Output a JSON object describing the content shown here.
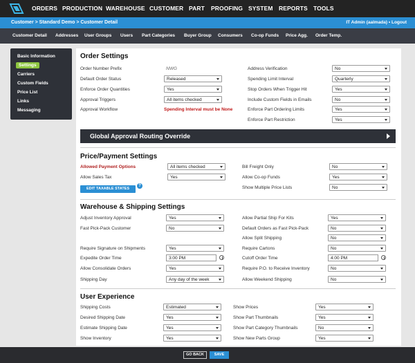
{
  "topnav": {
    "items": [
      "ORDERS",
      "PRODUCTION",
      "WAREHOUSE",
      "CUSTOMER",
      "PART",
      "PROOFING",
      "SYSTEM",
      "REPORTS",
      "TOOLS"
    ]
  },
  "breadcrumb": {
    "text": "Customer >  Standard Demo > Customer Detail",
    "user": "IT Admin (aalmada)",
    "separator": "•",
    "logout": "Logout"
  },
  "subnav": {
    "items": [
      "Customer Detail",
      "Addresses",
      "User Groups",
      "Users",
      "Part Categories",
      "Buyer Group",
      "Consumers",
      "Co-op Funds",
      "Price Agg.",
      "Order Temp."
    ]
  },
  "sidebar": {
    "items": [
      "Basic Information",
      "Settings",
      "Carriers",
      "Custom Fields",
      "Price List",
      "Links",
      "Messaging"
    ],
    "active": "Settings"
  },
  "order_settings": {
    "title": "Order Settings",
    "left": [
      {
        "label": "Order Number Prefix",
        "value": "NWG"
      },
      {
        "label": "Default Order Status",
        "value": "Released"
      },
      {
        "label": "Enforce Order Quantities",
        "value": "Yes"
      },
      {
        "label": "Approval Triggers",
        "value": "All items checked"
      },
      {
        "label": "Approval Workflow",
        "value": "Spending Interval must be None"
      }
    ],
    "right": [
      {
        "label": "Address Verification",
        "value": "No"
      },
      {
        "label": "Spending Limit Interval",
        "value": "Quarterly"
      },
      {
        "label": "Stop Orders When Trigger Hit",
        "value": "Yes"
      },
      {
        "label": "Include Custom Fields in Emails",
        "value": "No"
      },
      {
        "label": "Enforce Part Ordering Limits",
        "value": "Yes"
      },
      {
        "label": "Enforce Part Restriction",
        "value": "Yes"
      }
    ]
  },
  "global_approval": {
    "title": "Global Approval Routing Override"
  },
  "price_payment": {
    "title": "Price/Payment Settings",
    "left": [
      {
        "label": "Allowed Payment Options",
        "value": "All items checked"
      },
      {
        "label": "Allow Sales Tax",
        "value": "Yes"
      }
    ],
    "right": [
      {
        "label": "Bill Freight Only",
        "value": "No"
      },
      {
        "label": "Allow Co-op Funds",
        "value": "Yes"
      },
      {
        "label": "Show Multiple Price Lists",
        "value": "No"
      }
    ],
    "edit_button": "EDIT TAXABLE STATES",
    "help": "?"
  },
  "warehouse_shipping": {
    "title": "Warehouse & Shipping Settings",
    "left": [
      {
        "label": "Adjust Inventory Approval",
        "value": "Yes"
      },
      {
        "label": "Fast Pick-Pack Customer",
        "value": "No"
      },
      {
        "label": "Require Signature on Shipments",
        "value": "Yes"
      },
      {
        "label": "Expedite Order Time",
        "value": "3:00 PM"
      },
      {
        "label": "Allow Consolidate Orders",
        "value": "Yes"
      },
      {
        "label": "Shipping Day",
        "value": "Any day of the week"
      }
    ],
    "right": [
      {
        "label": "Allow Partial Ship For Kits",
        "value": "Yes"
      },
      {
        "label": "Default Orders as Fast Pick-Pack",
        "value": "No"
      },
      {
        "label": "Allow Split Shipping",
        "value": "No"
      },
      {
        "label": "Require Cartons",
        "value": "No"
      },
      {
        "label": "Cutoff Order Time",
        "value": "4:00 PM"
      },
      {
        "label": "Require P.O. to Receive Inventory",
        "value": "No"
      },
      {
        "label": "Allow Weekend Shipping",
        "value": "No"
      }
    ]
  },
  "user_experience": {
    "title": "User Experience",
    "left": [
      {
        "label": "Shipping Costs",
        "value": "Estimated"
      },
      {
        "label": "Desired Shipping Date",
        "value": "Yes"
      },
      {
        "label": "Estimate Shipping Date",
        "value": "Yes"
      },
      {
        "label": "Show Inventory",
        "value": "Yes"
      }
    ],
    "right": [
      {
        "label": "Show Prices",
        "value": "Yes"
      },
      {
        "label": "Show Part Thumbnails",
        "value": "Yes"
      },
      {
        "label": "Show Part Category Thumbnails",
        "value": "No"
      },
      {
        "label": "Show New Parts Group",
        "value": "Yes"
      }
    ]
  },
  "footer": {
    "go_back": "GO BACK",
    "save": "SAVE"
  },
  "colors": {
    "accent": "#2b8fd4",
    "active": "#8ec63f",
    "dark": "#2e3138"
  }
}
